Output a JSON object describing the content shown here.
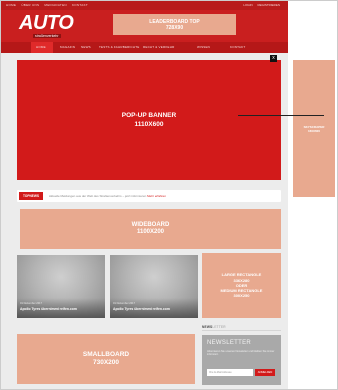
{
  "topbar": {
    "links": [
      "HOME",
      "ÜBER UNS",
      "MEDIADATEN",
      "KONTAKT"
    ],
    "right_links": [
      "LOGIN",
      "REGISTRIEREN"
    ]
  },
  "logo": {
    "text": "AUTO",
    "subtitle": "straßenverkehr"
  },
  "leaderboard": {
    "label": "LEADERBOARD TOP",
    "size": "728x90"
  },
  "nav": {
    "active": "HOME",
    "items": [
      "MAGAZIN",
      "NEWS",
      "TESTS & FAHRBERICHTE",
      "RECHT & VERKEHR",
      "WISSEN",
      "KONTAKT"
    ]
  },
  "popup": {
    "label": "POP-UP BANNER",
    "size": "1110x600",
    "close": "x"
  },
  "skyscraper": {
    "label": "SKYSCRAPER",
    "size": "160x600"
  },
  "ticker": {
    "badge": "TOPNEWS",
    "text": "Aktuelle Meldungen aus der Welt des Straßenverkehrs – jetzt informieren",
    "highlight": "Mehr erfahren"
  },
  "wideboard": {
    "label": "WIDEBOARD",
    "size": "1100x200"
  },
  "cards": [
    {
      "date": "01 Dezember 2017",
      "title": "Apollo Tyres übernimmt reifen.com"
    },
    {
      "date": "01 Dezember 2017",
      "title": "Apollo Tyres übernimmt reifen.com"
    }
  ],
  "large_rect": {
    "line1": "LARGE RECTANGLE",
    "line2": "336x280",
    "line3": "oder",
    "line4": "MEDIUM RECTANGLE",
    "line5": "300x250"
  },
  "smallboard": {
    "label": "SMALLBOARD",
    "size": "730X200"
  },
  "sidebar": {
    "heading_bold": "NEWS",
    "heading_thin": "LETTER",
    "newsletter": {
      "title": "NEWSLETTER",
      "text": "Abonnieren Sie unseren Newsletter und bleiben Sie immer informiert.",
      "placeholder": "Ihre E-Mail Adresse",
      "button": "ANMELDEN"
    }
  },
  "colors": {
    "brand_red": "#c91f1f",
    "ad_placeholder": "#e8a98f",
    "popup_red": "#d21a1a"
  }
}
